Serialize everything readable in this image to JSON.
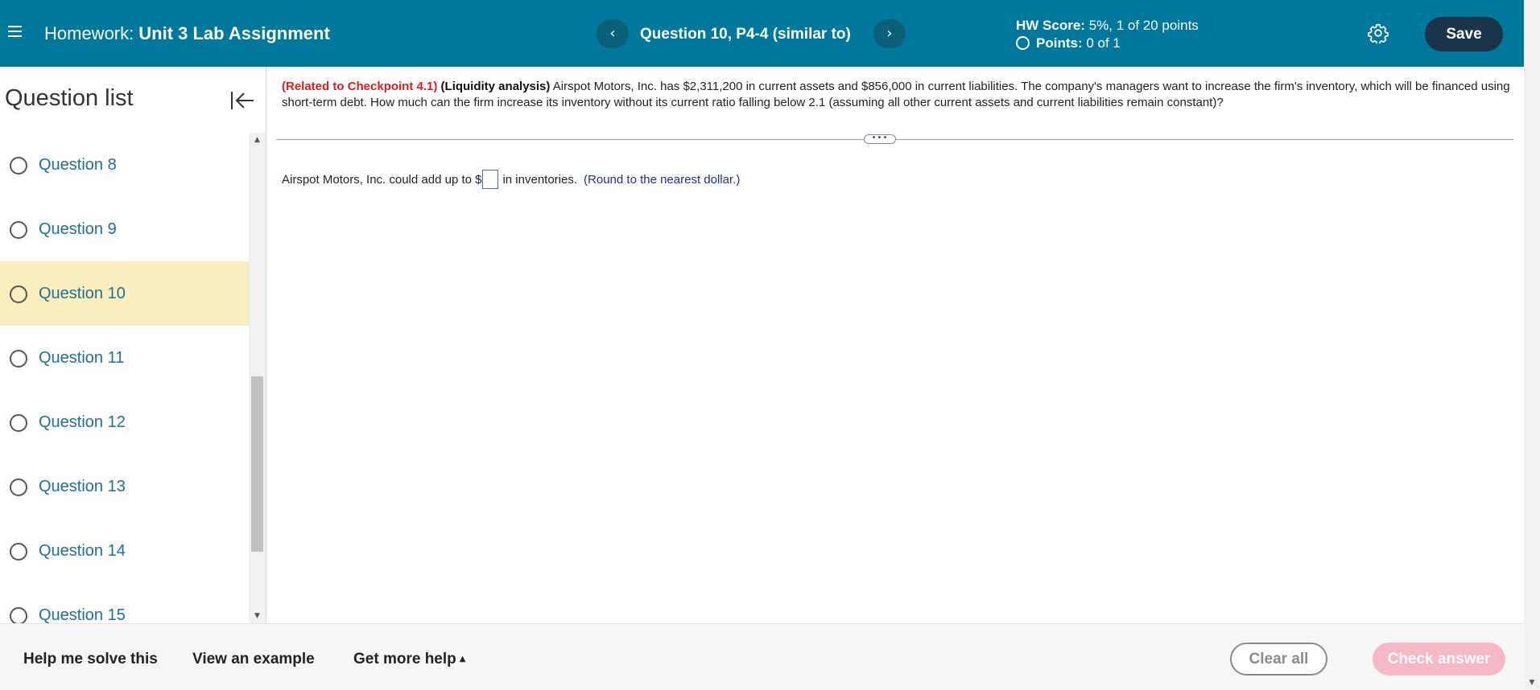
{
  "header": {
    "menu_icon": "hamburger-menu-icon",
    "title_prefix": "Homework:",
    "title_name": "Unit 3 Lab Assignment",
    "prev_label": "‹",
    "next_label": "›",
    "question_title": "Question 10, P4-4 (similar to)",
    "hw_score_label": "HW Score:",
    "hw_score_value": "5%, 1 of 20 points",
    "points_label": "Points:",
    "points_value": "0 of 1",
    "settings_icon": "gear-icon",
    "save_label": "Save"
  },
  "sidebar": {
    "title": "Question list",
    "collapse_icon": "collapse-left-icon",
    "items": [
      {
        "label": "Question 8"
      },
      {
        "label": "Question 9"
      },
      {
        "label": "Question 10"
      },
      {
        "label": "Question 11"
      },
      {
        "label": "Question 12"
      },
      {
        "label": "Question 13"
      },
      {
        "label": "Question 14"
      },
      {
        "label": "Question 15"
      }
    ],
    "active_item": "Question 10"
  },
  "question": {
    "ref": "(Related to Checkpoint 4.1)",
    "topic": "(Liquidity analysis)",
    "body": "Airspot Motors, Inc. has $2,311,200 in current assets and $856,000 in current liabilities.  The company's managers want to increase the firm's inventory, which will be financed using short-term debt.  How much can the firm increase its inventory without its current ratio falling below 2.1 (assuming all other current assets and current liabilities remain constant)?",
    "answer_prefix": "Airspot Motors, Inc. could add up to $",
    "answer_value": "",
    "answer_suffix": "in inventories.",
    "hint": "(Round to the nearest dollar.)",
    "divider_handle": "•••"
  },
  "footer": {
    "help_label": "Help me solve this",
    "example_label": "View an example",
    "more_help_label": "Get more help",
    "clear_label": "Clear all",
    "check_label": "Check answer"
  },
  "colors": {
    "header_bg": "#00789b",
    "save_bg": "#1b3448",
    "active_item_bg": "#fbeebe",
    "link_color": "#1c7194",
    "ref_color": "#e01d1d",
    "check_bg": "#f5b8c4"
  }
}
